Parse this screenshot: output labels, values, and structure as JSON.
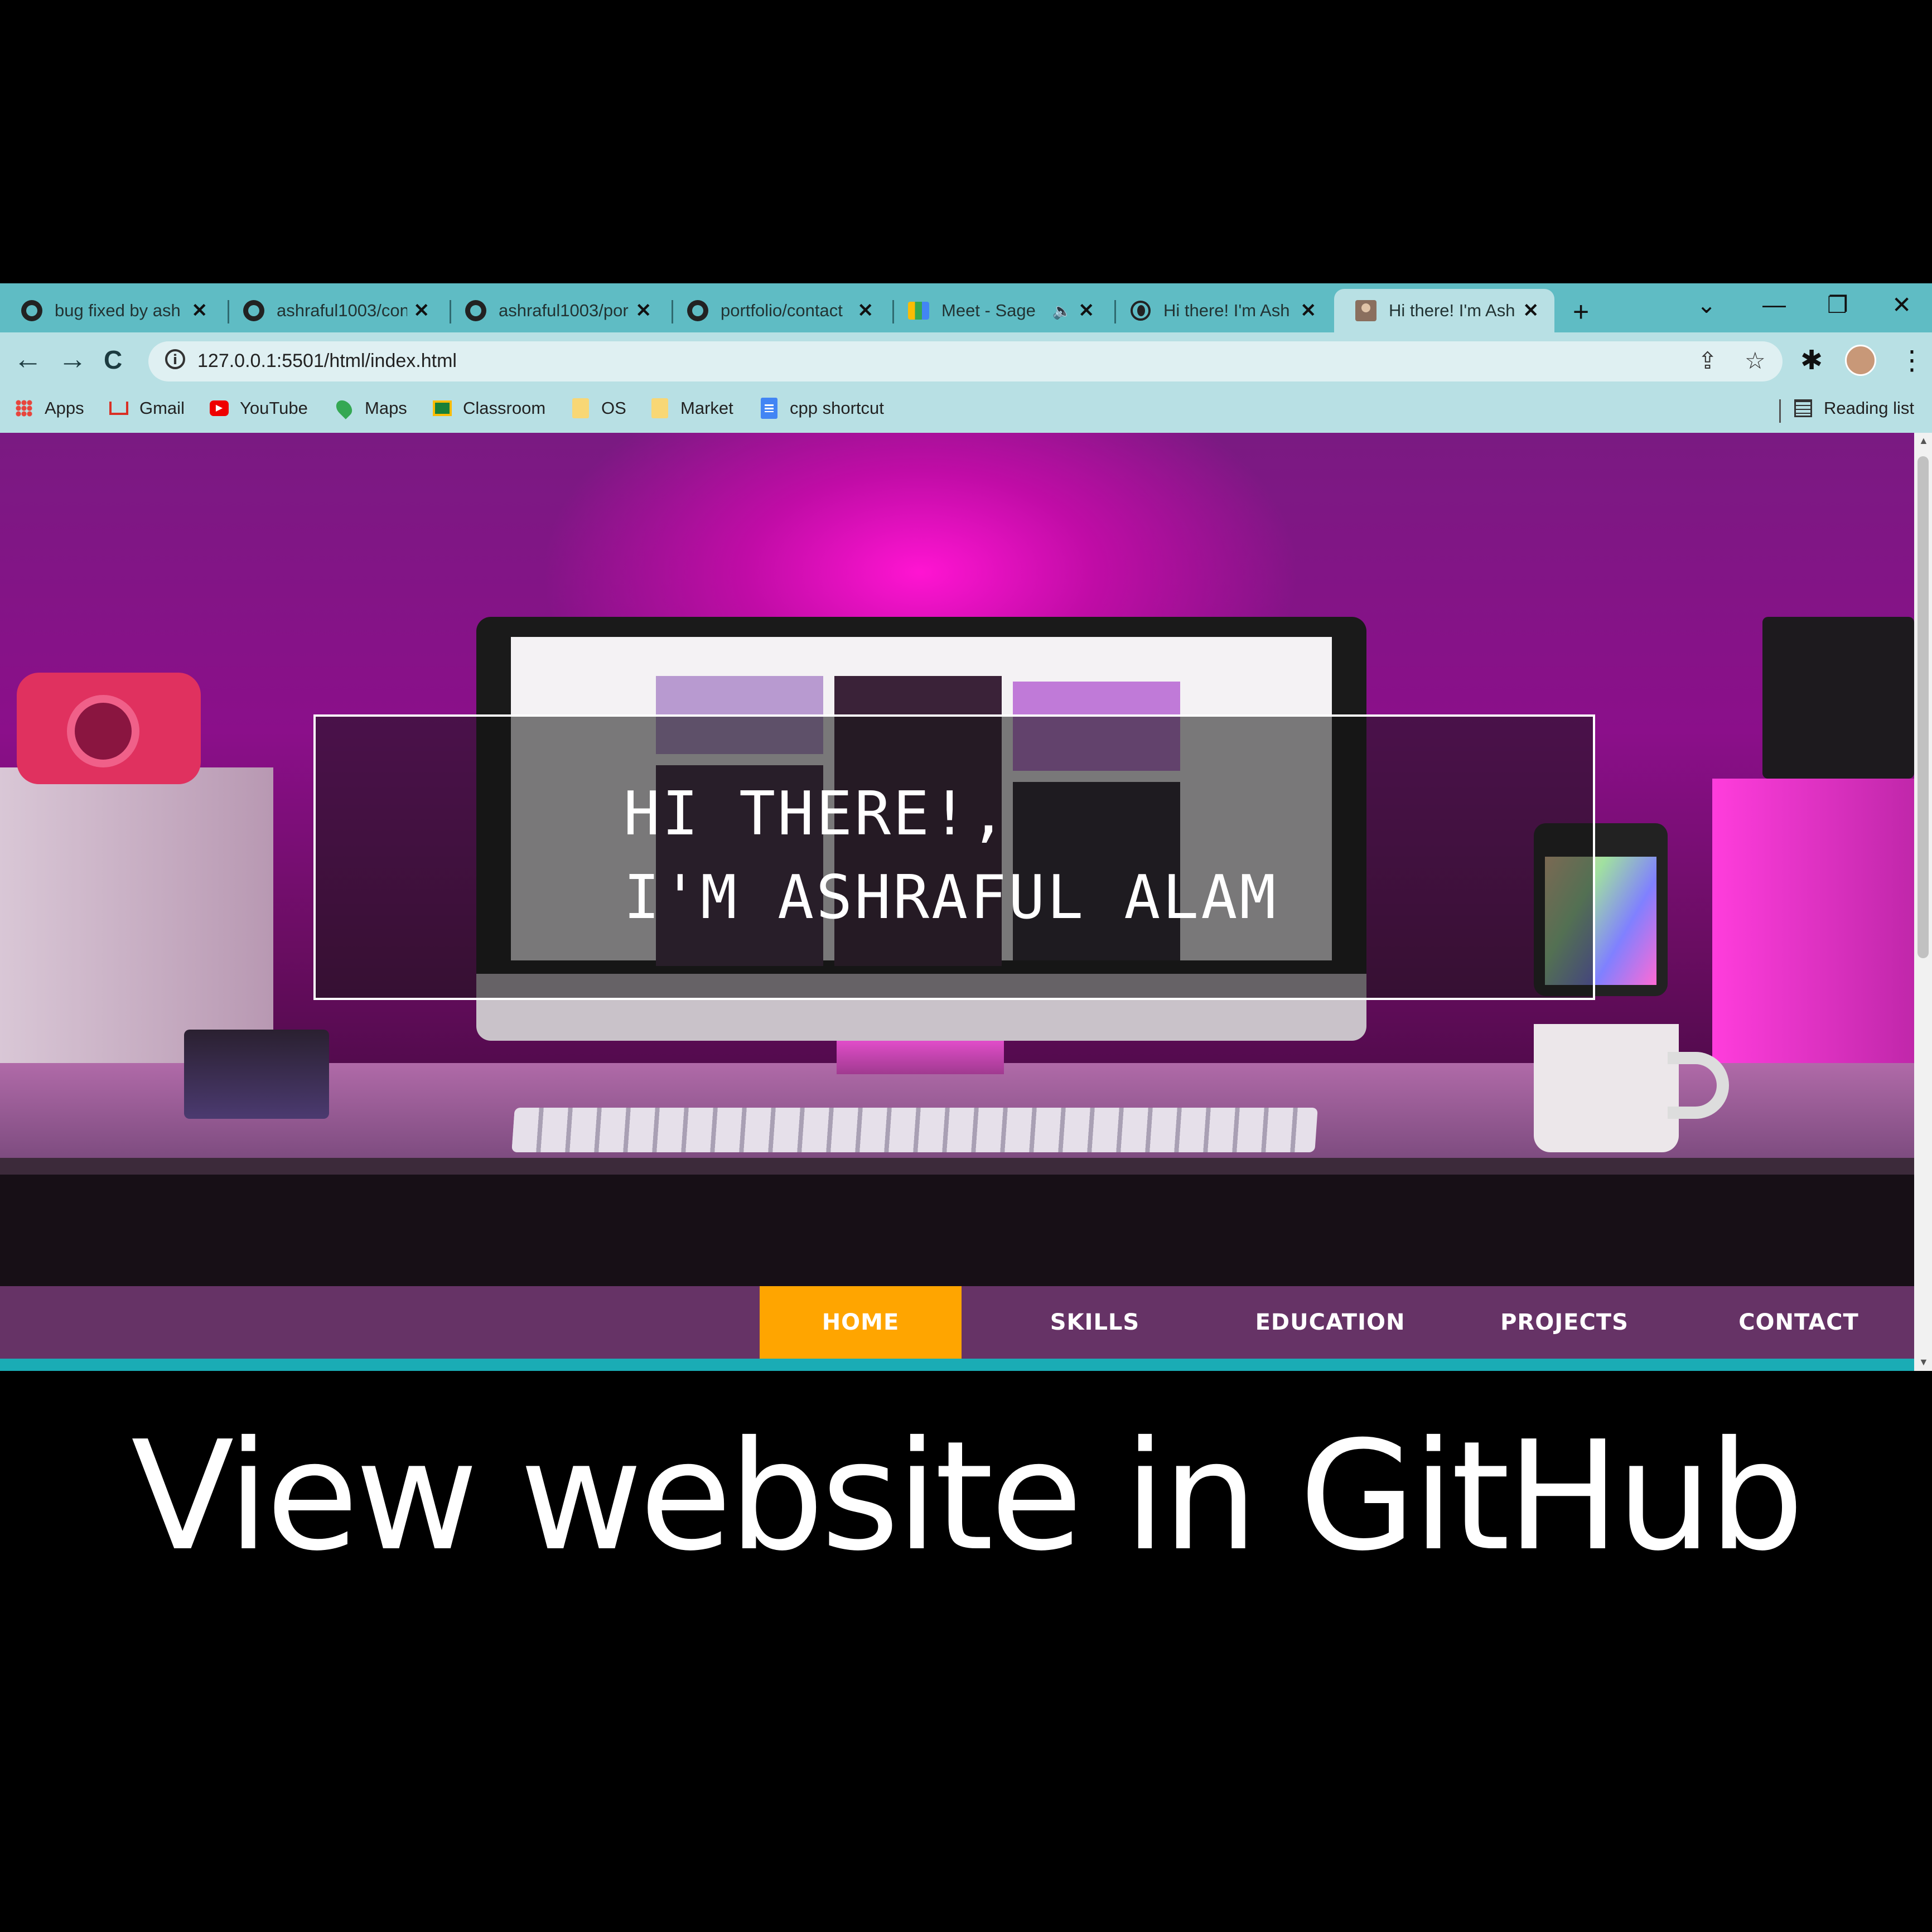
{
  "browser": {
    "tabs": [
      {
        "title": "bug fixed by ash",
        "icon": "github-icon"
      },
      {
        "title": "ashraful1003/con",
        "icon": "github-icon"
      },
      {
        "title": "ashraful1003/por",
        "icon": "github-icon"
      },
      {
        "title": "portfolio/contact",
        "icon": "github-icon"
      },
      {
        "title": "Meet - Sage",
        "icon": "google-meet-icon",
        "audio": "🔈"
      },
      {
        "title": "Hi there! I'm Ash",
        "icon": "globe-icon"
      },
      {
        "title": "Hi there! I'm Ash",
        "icon": "profile-photo-icon",
        "active": true
      }
    ],
    "tab_close_glyph": "✕",
    "new_tab_glyph": "+",
    "window_controls": {
      "tab_search": "⌄",
      "minimize": "—",
      "restore": "❐",
      "close": "✕"
    },
    "nav": {
      "back": "←",
      "forward": "→",
      "reload": "C"
    },
    "address": {
      "info_glyph": "i",
      "url": "127.0.0.1:5501/html/index.html"
    },
    "toolbar_icons": {
      "share": "⇪",
      "bookmark_star": "☆",
      "extensions": "✱",
      "menu": "⋮"
    },
    "bookmarks": [
      {
        "label": "Apps",
        "icon": "apps-icon"
      },
      {
        "label": "Gmail",
        "icon": "gmail-icon"
      },
      {
        "label": "YouTube",
        "icon": "youtube-icon"
      },
      {
        "label": "Maps",
        "icon": "maps-icon"
      },
      {
        "label": "Classroom",
        "icon": "classroom-icon"
      },
      {
        "label": "OS",
        "icon": "folder-icon"
      },
      {
        "label": "Market",
        "icon": "folder-icon"
      },
      {
        "label": "cpp shortcut",
        "icon": "docs-icon"
      }
    ],
    "reading_list": "Reading list"
  },
  "page": {
    "intro": {
      "line1": "HI THERE!,",
      "line2": "I'M ASHRAFUL ALAM"
    },
    "nav_items": [
      {
        "label": "HOME",
        "active": true
      },
      {
        "label": "SKILLS",
        "active": false
      },
      {
        "label": "EDUCATION",
        "active": false
      },
      {
        "label": "PROJECTS",
        "active": false
      },
      {
        "label": "CONTACT",
        "active": false
      }
    ],
    "colors": {
      "nav_bg": "#663366",
      "nav_active": "#ffa500",
      "nav_border": "#1aacb5",
      "tabstrip": "#5fbcc4"
    }
  },
  "caption": "View website in GitHub"
}
